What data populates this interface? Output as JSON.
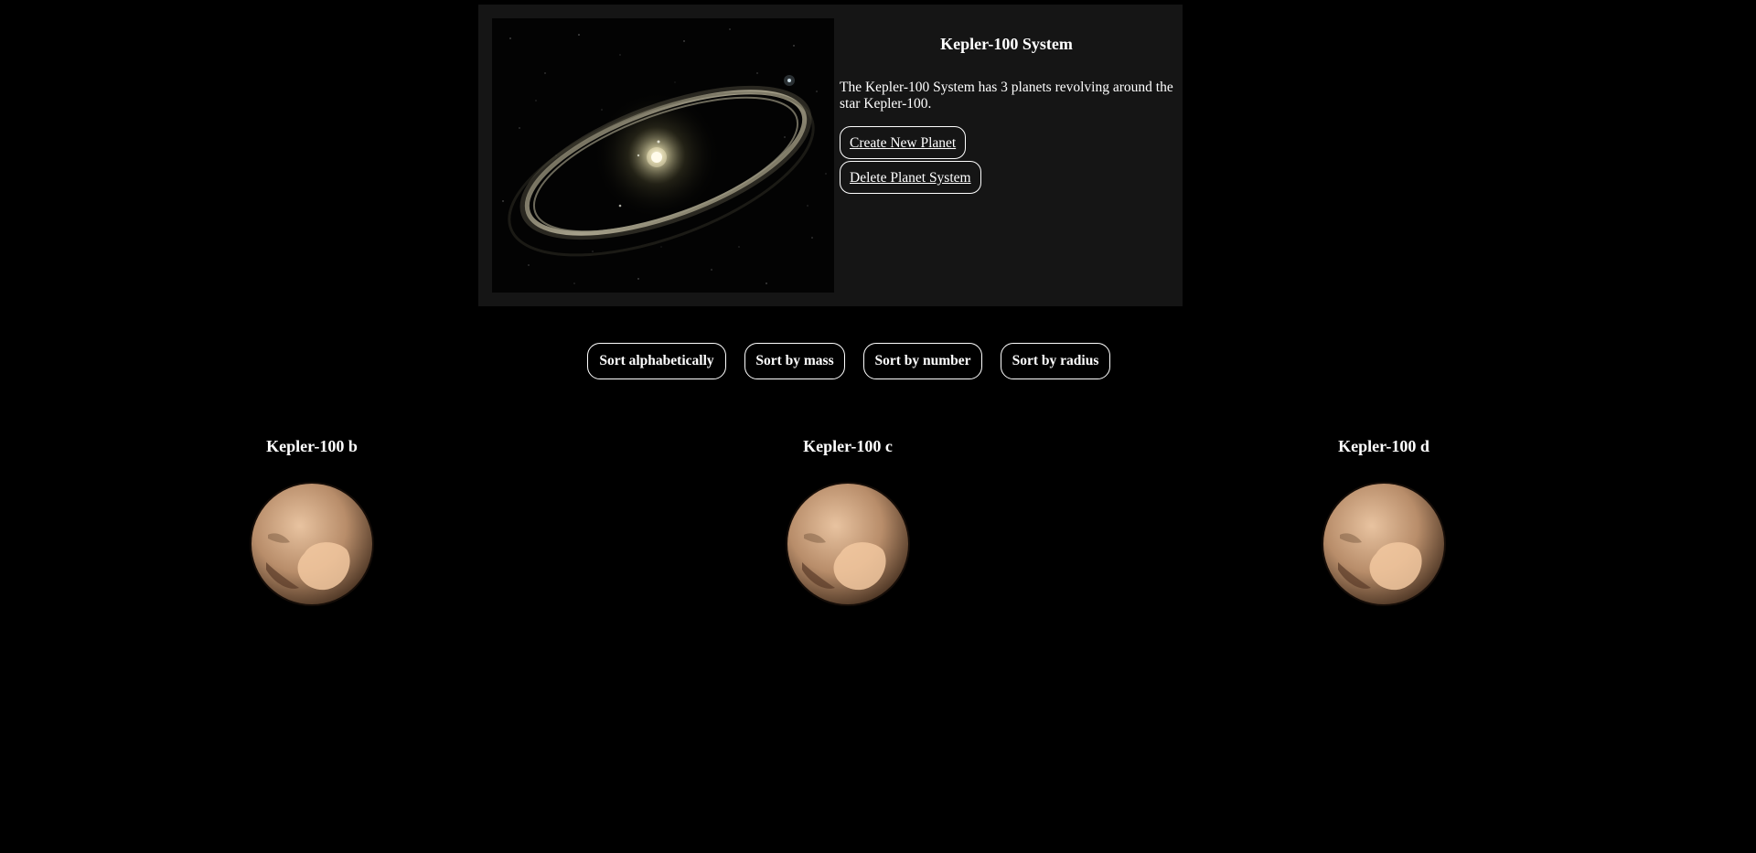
{
  "system": {
    "title": "Kepler-100 System",
    "description": "The Kepler-100 System has 3 planets revolving around the star Kepler-100.",
    "image_icon": "planet-system-ring-image",
    "create_label": "Create New Planet",
    "delete_label": "Delete Planet System"
  },
  "sort": {
    "alphabetical": "Sort alphabetically",
    "mass": "Sort by mass",
    "number": "Sort by number",
    "radius": "Sort by radius"
  },
  "planets": [
    {
      "name": "Kepler-100 b",
      "image_icon": "pluto-planet-image"
    },
    {
      "name": "Kepler-100 c",
      "image_icon": "pluto-planet-image"
    },
    {
      "name": "Kepler-100 d",
      "image_icon": "pluto-planet-image"
    }
  ],
  "colors": {
    "background": "#000000",
    "card_background": "#151515",
    "text": "#ffffff",
    "border": "#ffffff"
  }
}
